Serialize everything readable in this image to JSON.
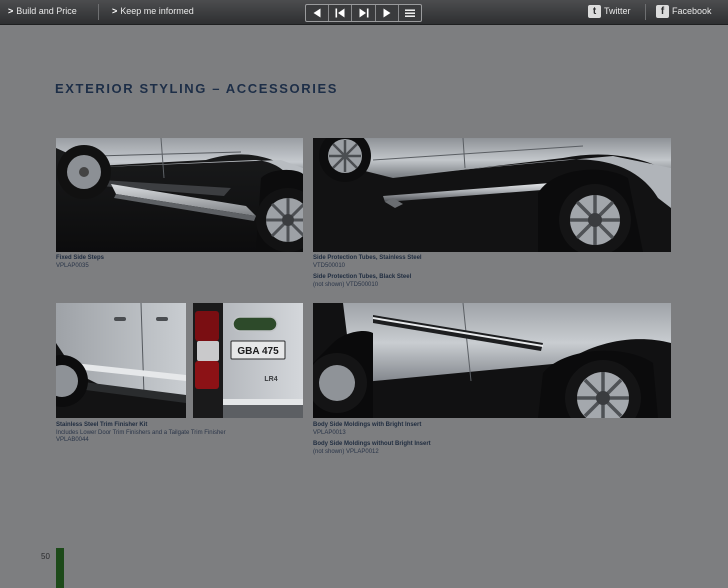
{
  "topbar": {
    "build_price": "Build and Price",
    "keep_informed": "Keep me informed",
    "twitter": "Twitter",
    "facebook": "Facebook",
    "chevron": ">"
  },
  "heading": "EXTERIOR STYLING – ACCESSORIES",
  "items": [
    {
      "lines": [
        {
          "text": "Fixed Side Steps",
          "bold": true
        },
        {
          "text": "VPLAP0035",
          "bold": false
        }
      ]
    },
    {
      "lines": [
        {
          "text": "Side Protection Tubes, Stainless Steel",
          "bold": true
        },
        {
          "text": "VTD500010",
          "bold": false
        },
        {
          "text": "Side Protection Tubes, Black Steel",
          "bold": true
        },
        {
          "text": "(not shown) VTD500010",
          "bold": false
        }
      ]
    },
    {
      "lines": [
        {
          "text": "Stainless Steel Trim Finisher Kit",
          "bold": true
        },
        {
          "text": "Includes Lower Door Trim Finishers and a Tailgate Trim Finisher",
          "bold": false
        },
        {
          "text": "VPLAB0044",
          "bold": false
        }
      ]
    },
    {
      "lines": [
        {
          "text": "Body Side Moldings with Bright Insert",
          "bold": true
        },
        {
          "text": "VPLAP0013",
          "bold": false
        },
        {
          "text": "Body Side Moldings without Bright Insert",
          "bold": true
        },
        {
          "text": "(not shown) VPLAP0012",
          "bold": false
        }
      ]
    }
  ],
  "plate": {
    "number": "GBA 475",
    "model": "LR4"
  },
  "page_number": "50",
  "colors": {
    "page_bg": "#7d7e80",
    "heading": "#1d2e47",
    "caption": "#1f2c3f",
    "page_marker": "#1d4a1a"
  }
}
